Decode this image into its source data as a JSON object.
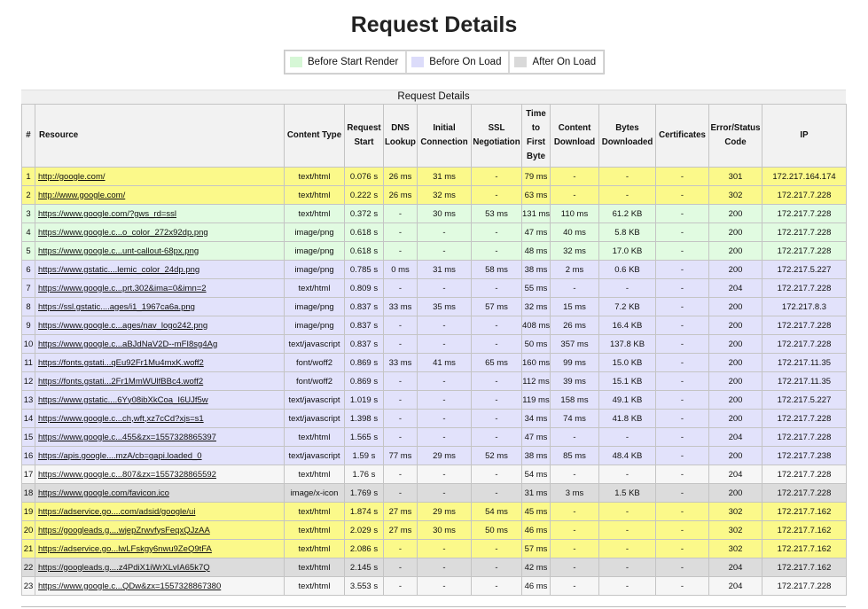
{
  "title": "Request Details",
  "legend": [
    {
      "label": "Before Start Render",
      "color": "#d6f7d6"
    },
    {
      "label": "Before On Load",
      "color": "#dcdcfa"
    },
    {
      "label": "After On Load",
      "color": "#d9d9d9"
    }
  ],
  "table": {
    "caption": "Request Details",
    "headers": [
      "#",
      "Resource",
      "Content Type",
      "Request Start",
      "DNS Lookup",
      "Initial Connection",
      "SSL Negotiation",
      "Time to First Byte",
      "Content Download",
      "Bytes Downloaded",
      "Certificates",
      "Error/Status Code",
      "IP"
    ],
    "rows": [
      {
        "cells": [
          "1",
          "http://google.com/",
          "text/html",
          "0.076 s",
          "26 ms",
          "31 ms",
          "-",
          "79 ms",
          "-",
          "-",
          "-",
          "301",
          "172.217.164.174"
        ],
        "color": "#fbf98a"
      },
      {
        "cells": [
          "2",
          "http://www.google.com/",
          "text/html",
          "0.222 s",
          "26 ms",
          "32 ms",
          "-",
          "63 ms",
          "-",
          "-",
          "-",
          "302",
          "172.217.7.228"
        ],
        "color": "#fbf98a"
      },
      {
        "cells": [
          "3",
          "https://www.google.com/?gws_rd=ssl",
          "text/html",
          "0.372 s",
          "-",
          "30 ms",
          "53 ms",
          "131 ms",
          "110 ms",
          "61.2 KB",
          "-",
          "200",
          "172.217.7.228"
        ],
        "color": "#e1fbe1"
      },
      {
        "cells": [
          "4",
          "https://www.google.c...o_color_272x92dp.png",
          "image/png",
          "0.618 s",
          "-",
          "-",
          "-",
          "47 ms",
          "40 ms",
          "5.8 KB",
          "-",
          "200",
          "172.217.7.228"
        ],
        "color": "#e1fbe1"
      },
      {
        "cells": [
          "5",
          "https://www.google.c...unt-callout-68px.png",
          "image/png",
          "0.618 s",
          "-",
          "-",
          "-",
          "48 ms",
          "32 ms",
          "17.0 KB",
          "-",
          "200",
          "172.217.7.228"
        ],
        "color": "#e1fbe1"
      },
      {
        "cells": [
          "6",
          "https://www.gstatic....lemic_color_24dp.png",
          "image/png",
          "0.785 s",
          "0 ms",
          "31 ms",
          "58 ms",
          "38 ms",
          "2 ms",
          "0.6 KB",
          "-",
          "200",
          "172.217.5.227"
        ],
        "color": "#e2e2fb"
      },
      {
        "cells": [
          "7",
          "https://www.google.c...prt.302&ima=0&imn=2",
          "text/html",
          "0.809 s",
          "-",
          "-",
          "-",
          "55 ms",
          "-",
          "-",
          "-",
          "204",
          "172.217.7.228"
        ],
        "color": "#e2e2fb"
      },
      {
        "cells": [
          "8",
          "https://ssl.gstatic....ages/i1_1967ca6a.png",
          "image/png",
          "0.837 s",
          "33 ms",
          "35 ms",
          "57 ms",
          "32 ms",
          "15 ms",
          "7.2 KB",
          "-",
          "200",
          "172.217.8.3"
        ],
        "color": "#e2e2fb"
      },
      {
        "cells": [
          "9",
          "https://www.google.c...ages/nav_logo242.png",
          "image/png",
          "0.837 s",
          "-",
          "-",
          "-",
          "408 ms",
          "26 ms",
          "16.4 KB",
          "-",
          "200",
          "172.217.7.228"
        ],
        "color": "#e2e2fb"
      },
      {
        "cells": [
          "10",
          "https://www.google.c...aBJdNaV2D--mFI8sg4Ag",
          "text/javascript",
          "0.837 s",
          "-",
          "-",
          "-",
          "50 ms",
          "357 ms",
          "137.8 KB",
          "-",
          "200",
          "172.217.7.228"
        ],
        "color": "#e2e2fb"
      },
      {
        "cells": [
          "11",
          "https://fonts.gstati...qEu92Fr1Mu4mxK.woff2",
          "font/woff2",
          "0.869 s",
          "33 ms",
          "41 ms",
          "65 ms",
          "160 ms",
          "99 ms",
          "15.0 KB",
          "-",
          "200",
          "172.217.11.35"
        ],
        "color": "#e2e2fb"
      },
      {
        "cells": [
          "12",
          "https://fonts.gstati...2Fr1MmWUlfBBc4.woff2",
          "font/woff2",
          "0.869 s",
          "-",
          "-",
          "-",
          "112 ms",
          "39 ms",
          "15.1 KB",
          "-",
          "200",
          "172.217.11.35"
        ],
        "color": "#e2e2fb"
      },
      {
        "cells": [
          "13",
          "https://www.gstatic....6Yy08ibXkCoa_I6UJf5w",
          "text/javascript",
          "1.019 s",
          "-",
          "-",
          "-",
          "119 ms",
          "158 ms",
          "49.1 KB",
          "-",
          "200",
          "172.217.5.227"
        ],
        "color": "#e2e2fb"
      },
      {
        "cells": [
          "14",
          "https://www.google.c...ch,wft,xz7cCd?xjs=s1",
          "text/javascript",
          "1.398 s",
          "-",
          "-",
          "-",
          "34 ms",
          "74 ms",
          "41.8 KB",
          "-",
          "200",
          "172.217.7.228"
        ],
        "color": "#e2e2fb"
      },
      {
        "cells": [
          "15",
          "https://www.google.c...455&zx=1557328865397",
          "text/html",
          "1.565 s",
          "-",
          "-",
          "-",
          "47 ms",
          "-",
          "-",
          "-",
          "204",
          "172.217.7.228"
        ],
        "color": "#e2e2fb"
      },
      {
        "cells": [
          "16",
          "https://apis.google....mzA/cb=gapi.loaded_0",
          "text/javascript",
          "1.59 s",
          "77 ms",
          "29 ms",
          "52 ms",
          "38 ms",
          "85 ms",
          "48.4 KB",
          "-",
          "200",
          "172.217.7.238"
        ],
        "color": "#e2e2fb"
      },
      {
        "cells": [
          "17",
          "https://www.google.c...807&zx=1557328865592",
          "text/html",
          "1.76 s",
          "-",
          "-",
          "-",
          "54 ms",
          "-",
          "-",
          "-",
          "204",
          "172.217.7.228"
        ],
        "color": "#f6f6f6"
      },
      {
        "cells": [
          "18",
          "https://www.google.com/favicon.ico",
          "image/x-icon",
          "1.769 s",
          "-",
          "-",
          "-",
          "31 ms",
          "3 ms",
          "1.5 KB",
          "-",
          "200",
          "172.217.7.228"
        ],
        "color": "#dcdcdc"
      },
      {
        "cells": [
          "19",
          "https://adservice.go....com/adsid/google/ui",
          "text/html",
          "1.874 s",
          "27 ms",
          "29 ms",
          "54 ms",
          "45 ms",
          "-",
          "-",
          "-",
          "302",
          "172.217.7.162"
        ],
        "color": "#fbf98a"
      },
      {
        "cells": [
          "20",
          "https://googleads.g....wjepZrwvfysFeqxQJzAA",
          "text/html",
          "2.029 s",
          "27 ms",
          "30 ms",
          "50 ms",
          "46 ms",
          "-",
          "-",
          "-",
          "302",
          "172.217.7.162"
        ],
        "color": "#fbf98a"
      },
      {
        "cells": [
          "21",
          "https://adservice.go...lwLFskgy6nwu9ZeQ9tFA",
          "text/html",
          "2.086 s",
          "-",
          "-",
          "-",
          "57 ms",
          "-",
          "-",
          "-",
          "302",
          "172.217.7.162"
        ],
        "color": "#fbf98a"
      },
      {
        "cells": [
          "22",
          "https://googleads.g....z4PdiX1iWrXLvIA65k7Q",
          "text/html",
          "2.145 s",
          "-",
          "-",
          "-",
          "42 ms",
          "-",
          "-",
          "-",
          "204",
          "172.217.7.162"
        ],
        "color": "#dcdcdc"
      },
      {
        "cells": [
          "23",
          "https://www.google.c...QDw&zx=1557328867380",
          "text/html",
          "3.553 s",
          "-",
          "-",
          "-",
          "46 ms",
          "-",
          "-",
          "-",
          "204",
          "172.217.7.228"
        ],
        "color": "#f6f6f6"
      }
    ]
  }
}
